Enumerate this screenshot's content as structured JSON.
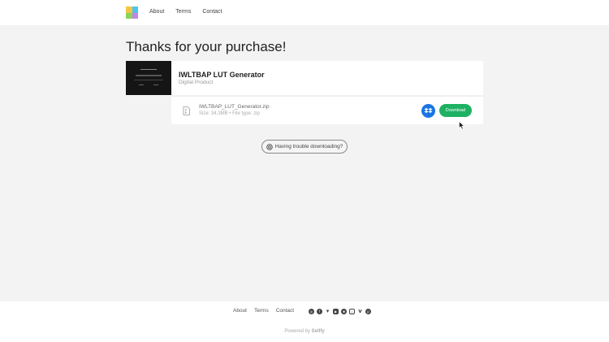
{
  "header": {
    "nav": [
      "About",
      "Terms",
      "Contact"
    ],
    "logo_colors": [
      "#f4c542",
      "#4cc3f0",
      "#8bd35a",
      "#c784e0"
    ]
  },
  "main": {
    "title": "Thanks for your purchase!",
    "product": {
      "name": "IWLTBAP LUT Generator",
      "type": "Digital Product"
    },
    "file": {
      "name": "IWLTBAP_LUT_Generator.zip",
      "meta": "Size: 34.3MB • File type: zip"
    },
    "download_label": "Download",
    "trouble_label": "Having trouble downloading?"
  },
  "footer": {
    "nav": [
      "About",
      "Terms",
      "Contact"
    ],
    "socials": [
      "website-icon",
      "facebook-icon",
      "twitter-icon",
      "youtube-icon",
      "dribbble-icon",
      "instagram-icon",
      "vimeo-icon",
      "pinterest-icon"
    ],
    "powered_prefix": "Powered by",
    "powered_brand": "Sellfy"
  },
  "colors": {
    "download_green": "#1fb163",
    "dropbox_blue": "#1b74e4"
  }
}
